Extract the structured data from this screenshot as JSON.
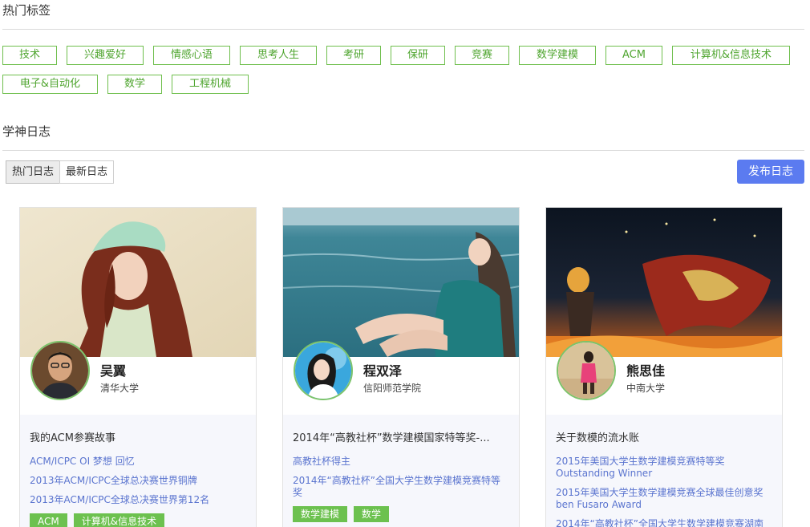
{
  "hot_tags": {
    "title": "热门标签",
    "items": [
      "技术",
      "兴趣爱好",
      "情感心语",
      "思考人生",
      "考研",
      "保研",
      "竞赛",
      "数学建模",
      "ACM",
      "计算机&信息技术",
      "电子&自动化",
      "数学",
      "工程机械"
    ]
  },
  "journal": {
    "title": "学神日志",
    "tabs": [
      "热门日志",
      "最新日志"
    ],
    "publish_label": "发布日志"
  },
  "cards": [
    {
      "name": "吴翼",
      "school": "清华大学",
      "post_title": "我的ACM参赛故事",
      "links": [
        "ACM/ICPC  OI  梦想  回忆",
        "2013年ACM/ICPC全球总决赛世界铜牌",
        "2013年ACM/ICPC全球总决赛世界第12名"
      ],
      "tags": [
        "ACM",
        "计算机&信息技术"
      ]
    },
    {
      "name": "程双泽",
      "school": "信阳师范学院",
      "post_title": "2014年“高教社杯”数学建模国家特等奖-...",
      "links": [
        "高教社杯得主",
        "2014年“高教社杯”全国大学生数学建模竞赛特等奖"
      ],
      "tags": [
        "数学建模",
        "数学"
      ]
    },
    {
      "name": "熊思佳",
      "school": "中南大学",
      "post_title": "关于数模的流水账",
      "links": [
        "2015年美国大学生数学建模竞赛特等奖 Outstanding Winner",
        "2015年美国大学生数学建模竞赛全球最佳创意奖 ben Fusaro Award",
        "2014年“高教社杯”全国大学生数学建模竞赛湖南"
      ],
      "tags": []
    }
  ],
  "colors": {
    "tag_border": "#6fbf4d",
    "tag_text": "#4fa52f",
    "primary_button": "#5b7bf0",
    "link": "#5a74cf",
    "card_tag_bg": "#6cc14f"
  }
}
